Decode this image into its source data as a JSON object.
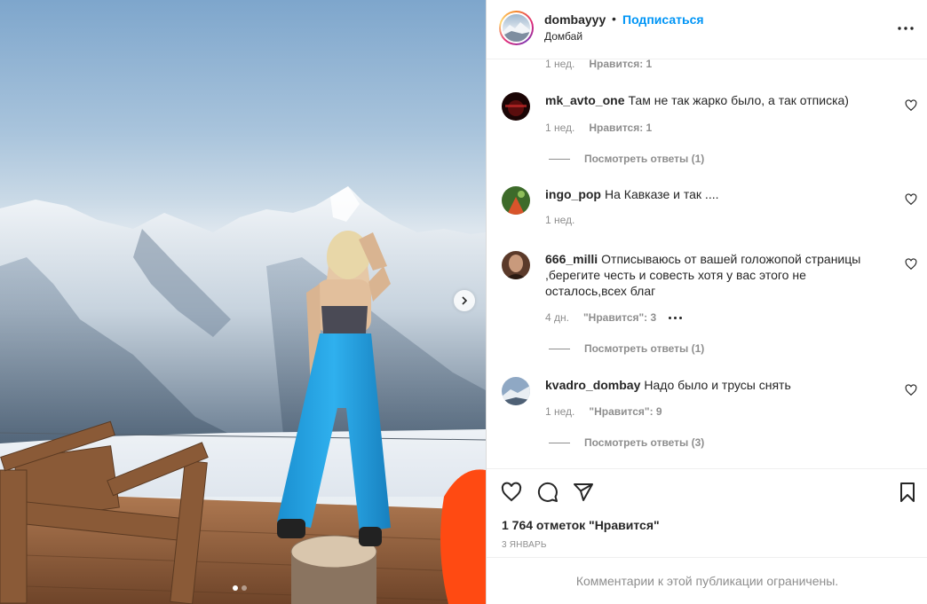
{
  "post": {
    "username": "dombayyy",
    "separator": "•",
    "follow_label": "Подписаться",
    "location": "Домбай",
    "top_comment_meta": {
      "time": "1 нед.",
      "likes": "Нравится: 1"
    },
    "comments": [
      {
        "username": "mk_avto_one",
        "text": "Там не так жарко было, а так отписка)",
        "time": "1 нед.",
        "likes": "Нравится: 1",
        "replies": "Посмотреть ответы (1)"
      },
      {
        "username": "ingo_pop",
        "text": "На Кавказе и так ....",
        "time": "1 нед.",
        "likes": "",
        "replies": ""
      },
      {
        "username": "666_milli",
        "text": "Отписываюсь от вашей голожопой страницы ,берегите честь и совесть хотя у вас этого не осталось,всех благ",
        "time": "4 дн.",
        "likes": "\"Нравится\": 3",
        "replies": "Посмотреть ответы (1)"
      },
      {
        "username": "kvadro_dombay",
        "text": "Надо было и трусы снять",
        "time": "1 нед.",
        "likes": "\"Нравится\": 9",
        "replies": "Посмотреть ответы (3)"
      }
    ],
    "likes_total": "1 764 отметок \"Нравится\"",
    "date": "3 ЯНВАРЬ",
    "comments_limited": "Комментарии к этой публикации ограничены."
  },
  "icons": {
    "more": "more-horizontal-icon",
    "next": "chevron-right-icon",
    "like": "heart-icon",
    "comment": "comment-icon",
    "share": "paper-plane-icon",
    "save": "bookmark-icon"
  },
  "colors": {
    "link": "#0095f6",
    "muted": "#8e8e8e",
    "text": "#262626",
    "border": "#dbdbdb"
  }
}
